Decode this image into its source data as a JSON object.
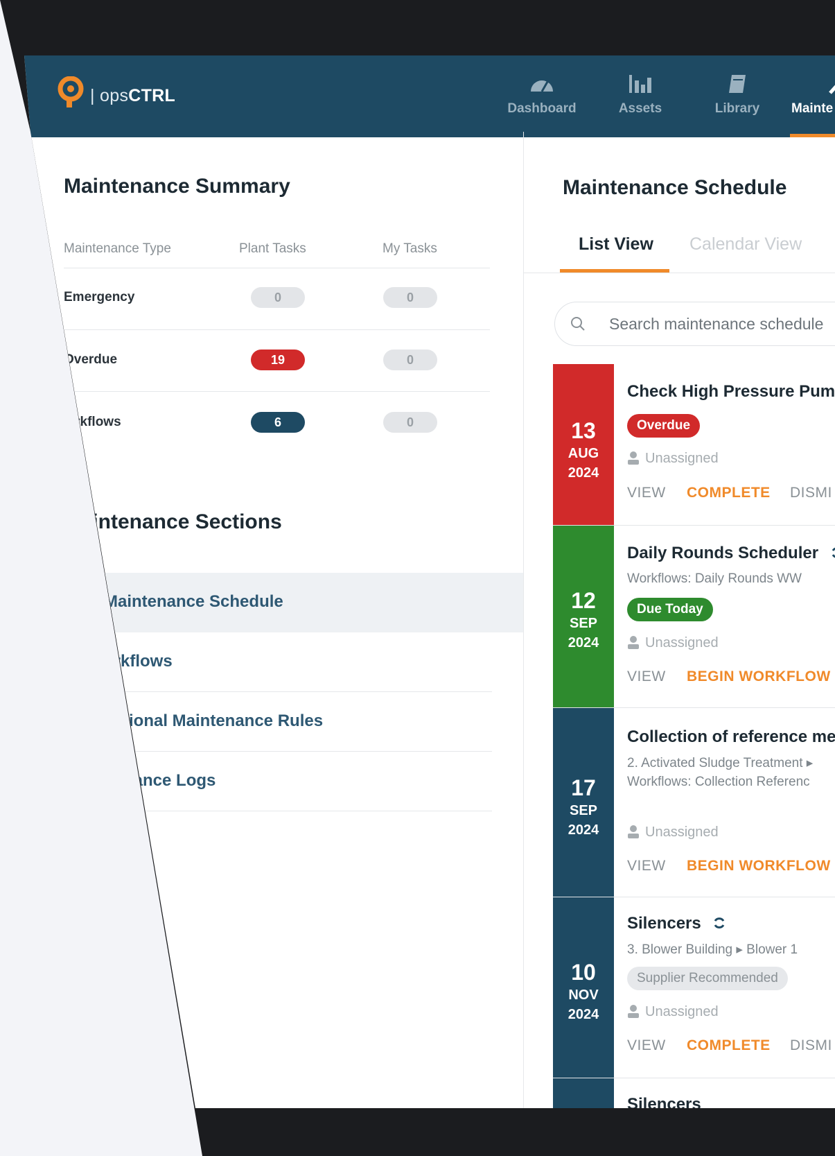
{
  "app": {
    "logo_text_light": "| ops",
    "logo_text_bold": "CTRL",
    "accent": "#f08a2a",
    "navy": "#1e4a63"
  },
  "nav": [
    {
      "label": "Dashboard",
      "icon": "gauge-icon"
    },
    {
      "label": "Assets",
      "icon": "bar-chart-icon"
    },
    {
      "label": "Library",
      "icon": "book-icon"
    },
    {
      "label": "Mainte",
      "icon": "wrench-icon",
      "active": true
    }
  ],
  "summary": {
    "title": "Maintenance Summary",
    "columns": [
      "Maintenance Type",
      "Plant Tasks",
      "My Tasks"
    ],
    "rows": [
      {
        "type": "Emergency",
        "plant": "0",
        "mine": "0"
      },
      {
        "type": "Overdue",
        "plant": "19",
        "mine": "0"
      },
      {
        "type": "'orkflows",
        "plant": "6",
        "mine": "0"
      }
    ]
  },
  "sections": {
    "title": "iintenance Sections",
    "items": [
      "Maintenance Schedule",
      "orkflows",
      "iditional Maintenance Rules",
      "itenance Logs"
    ]
  },
  "schedule": {
    "title": "Maintenance Schedule",
    "tabs": [
      "List View",
      "Calendar View"
    ],
    "search_placeholder": "Search maintenance schedule",
    "cards": [
      {
        "day": "13",
        "month": "AUG",
        "year": "2024",
        "color": "#d12a2a",
        "title": "Check High Pressure Pump",
        "badge": "Overdue",
        "assignee": "Unassigned",
        "actions": [
          "VIEW",
          "COMPLETE",
          "DISMI"
        ]
      },
      {
        "day": "12",
        "month": "SEP",
        "year": "2024",
        "color": "#2e8b2e",
        "title": "Daily Rounds Scheduler",
        "sub1": "Workflows: Daily Rounds WW",
        "badge": "Due Today",
        "assignee": "Unassigned",
        "actions": [
          "VIEW",
          "BEGIN WORKFLOW"
        ]
      },
      {
        "day": "17",
        "month": "SEP",
        "year": "2024",
        "color": "#1e4a63",
        "title": "Collection of reference mea",
        "sub1": "2. Activated Sludge Treatment ▸",
        "sub2": "Workflows: Collection Referenc",
        "assignee": "Unassigned",
        "actions": [
          "VIEW",
          "BEGIN WORKFLOW"
        ]
      },
      {
        "day": "10",
        "month": "NOV",
        "year": "2024",
        "color": "#1e4a63",
        "title": "Silencers",
        "sub1": "3. Blower Building ▸ Blower 1",
        "badge": "Supplier Recommended",
        "assignee": "Unassigned",
        "actions": [
          "VIEW",
          "COMPLETE",
          "DISMI"
        ]
      },
      {
        "color": "#1e4a63",
        "title": "Silencers"
      }
    ]
  }
}
